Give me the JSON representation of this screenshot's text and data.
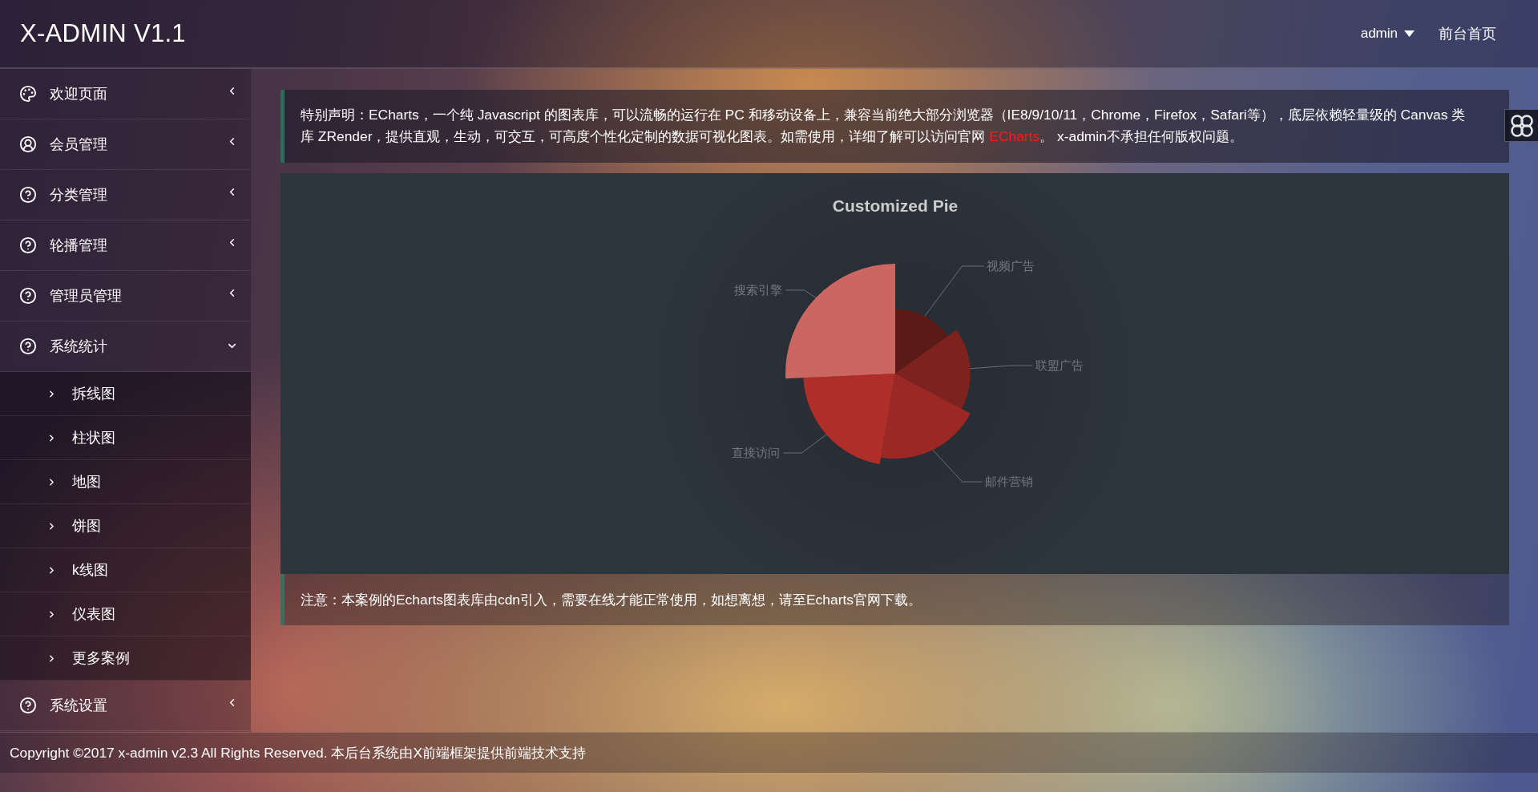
{
  "header": {
    "title": "X-ADMIN V1.1",
    "user_menu": "admin",
    "home_link": "前台首页"
  },
  "sidebar": {
    "items": [
      {
        "label": "欢迎页面",
        "expanded": false
      },
      {
        "label": "会员管理",
        "expanded": false
      },
      {
        "label": "分类管理",
        "expanded": false
      },
      {
        "label": "轮播管理",
        "expanded": false
      },
      {
        "label": "管理员管理",
        "expanded": false
      },
      {
        "label": "系统统计",
        "expanded": true,
        "children": [
          {
            "label": "拆线图"
          },
          {
            "label": "柱状图"
          },
          {
            "label": "地图"
          },
          {
            "label": "饼图"
          },
          {
            "label": "k线图"
          },
          {
            "label": "仪表图"
          },
          {
            "label": "更多案例"
          }
        ]
      },
      {
        "label": "系统设置",
        "expanded": false
      }
    ]
  },
  "notice": {
    "text_before": "特别声明：ECharts，一个纯 Javascript 的图表库，可以流畅的运行在 PC 和移动设备上，兼容当前绝大部分浏览器（IE8/9/10/11，Chrome，Firefox，Safari等），底层依赖轻量级的 Canvas 类库 ZRender，提供直观，生动，可交互，可高度个性化定制的数据可视化图表。如需使用，详细了解可以访问官网 ",
    "link": "ECharts",
    "text_after": "。 x-admin不承担任何版权问题。"
  },
  "chart": {
    "title": "Customized Pie",
    "slices": [
      {
        "label": "视频广告",
        "color": "#5c1a17"
      },
      {
        "label": "联盟广告",
        "color": "#7e221e"
      },
      {
        "label": "邮件营销",
        "color": "#9c2825"
      },
      {
        "label": "直接访问",
        "color": "#b02e29"
      },
      {
        "label": "搜索引擎",
        "color": "#cc6661"
      }
    ]
  },
  "note": "注意：本案例的Echarts图表库由cdn引入，需要在线才能正常使用，如想离想，请至Echarts官网下载。",
  "footer": "Copyright ©2017 x-admin v2.3 All Rights Reserved. 本后台系统由X前端框架提供前端技术支持"
}
